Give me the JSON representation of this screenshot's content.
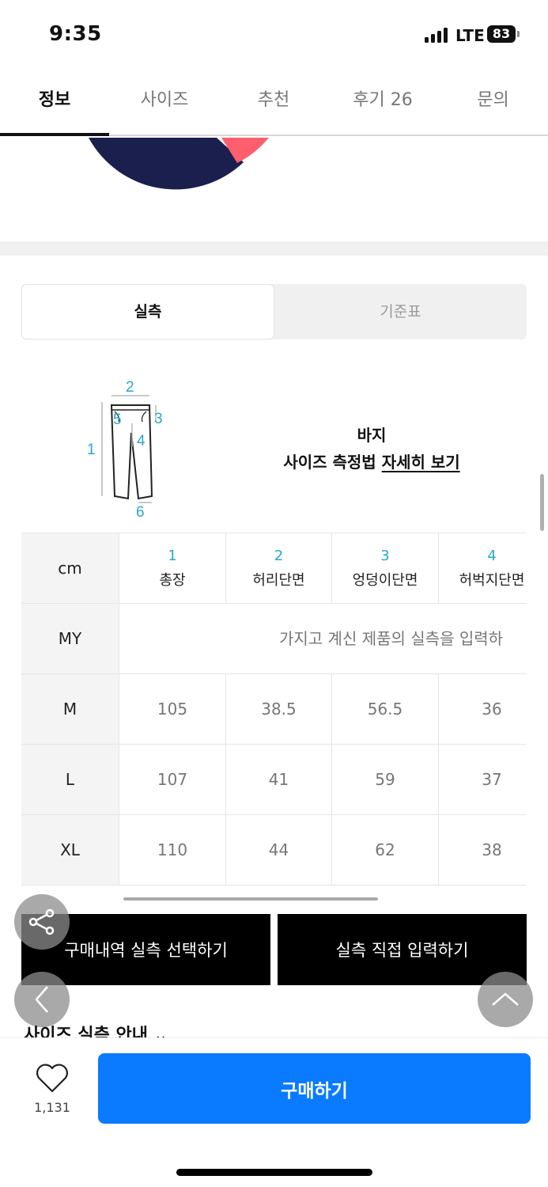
{
  "status": {
    "time": "9:35",
    "network": "LTE",
    "battery": "83"
  },
  "tabs": [
    {
      "label": "정보"
    },
    {
      "label": "사이즈"
    },
    {
      "label": "추천"
    },
    {
      "label": "후기 26"
    },
    {
      "label": "문의"
    }
  ],
  "size_toggle": {
    "measured": "실측",
    "standard": "기준표"
  },
  "diagram": {
    "labels": [
      "1",
      "2",
      "3",
      "4",
      "5",
      "6"
    ],
    "title_line1": "바지",
    "title_prefix": "사이즈 측정법",
    "title_link": "자세히 보기"
  },
  "table": {
    "unit": "cm",
    "columns": [
      {
        "num": "1",
        "label": "총장"
      },
      {
        "num": "2",
        "label": "허리단면"
      },
      {
        "num": "3",
        "label": "엉덩이단면"
      },
      {
        "num": "4",
        "label": "허벅지단면"
      }
    ],
    "my_row": {
      "label": "MY",
      "text": "가지고 계신 제품의 실측을 입력하"
    },
    "rows": [
      {
        "size": "M",
        "values": [
          "105",
          "38.5",
          "56.5",
          "36"
        ]
      },
      {
        "size": "L",
        "values": [
          "107",
          "41",
          "59",
          "37"
        ]
      },
      {
        "size": "XL",
        "values": [
          "110",
          "44",
          "62",
          "38"
        ]
      }
    ]
  },
  "actions": {
    "select_history": "구매내역 실측 선택하기",
    "manual_input": "실측 직접 입력하기"
  },
  "guide_text": "사이즈 실측 안내",
  "bottom": {
    "like_count": "1,131",
    "buy_label": "구매하기"
  },
  "colors": {
    "accent_blue": "#0a7bff",
    "number_cyan": "#2aa7c9",
    "pie_navy": "#1b1f4e",
    "pie_coral": "#ff5f6d"
  }
}
